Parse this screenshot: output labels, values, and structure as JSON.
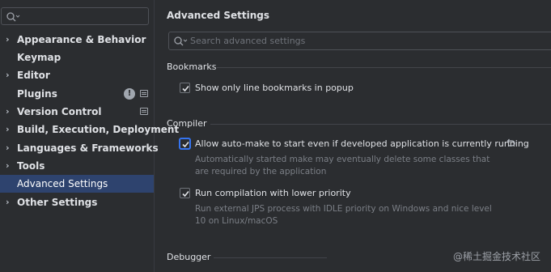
{
  "sidebar": {
    "search": {
      "placeholder": "",
      "value": ""
    },
    "items": [
      {
        "label": "Appearance & Behavior",
        "expandable": true,
        "selected": false
      },
      {
        "label": "Keymap",
        "expandable": false,
        "selected": false
      },
      {
        "label": "Editor",
        "expandable": true,
        "selected": false
      },
      {
        "label": "Plugins",
        "expandable": false,
        "selected": false,
        "badges": [
          "info-icon",
          "settings-sync-icon"
        ]
      },
      {
        "label": "Version Control",
        "expandable": true,
        "selected": false,
        "badges": [
          "settings-sync-icon"
        ]
      },
      {
        "label": "Build, Execution, Deployment",
        "expandable": true,
        "selected": false
      },
      {
        "label": "Languages & Frameworks",
        "expandable": true,
        "selected": false
      },
      {
        "label": "Tools",
        "expandable": true,
        "selected": false
      },
      {
        "label": "Advanced Settings",
        "expandable": false,
        "selected": true
      },
      {
        "label": "Other Settings",
        "expandable": true,
        "selected": false
      }
    ]
  },
  "main": {
    "title": "Advanced Settings",
    "search": {
      "placeholder": "Search advanced settings",
      "value": ""
    },
    "sections": [
      {
        "title": "Bookmarks",
        "options": [
          {
            "label": "Show only line bookmarks in popup",
            "checked": true,
            "description": ""
          }
        ]
      },
      {
        "title": "Compiler",
        "options": [
          {
            "label": "Allow auto-make to start even if developed application is currently running",
            "checked": true,
            "focused": true,
            "modified": true,
            "description_lines": [
              "Automatically started make may eventually delete some classes that",
              "are required by the application"
            ]
          },
          {
            "label": "Run compilation with lower priority",
            "checked": true,
            "description_lines": [
              "Run external JPS process with IDLE priority on Windows and nice level",
              "10 on Linux/macOS"
            ]
          }
        ]
      },
      {
        "title": "Debugger",
        "options": []
      }
    ]
  },
  "watermark": "@稀土掘金技术社区",
  "colors": {
    "background": "#2b2d30",
    "selection": "#2e436e",
    "focus": "#3574f0",
    "text": "#dfe1e5",
    "muted": "#7b7f86"
  }
}
